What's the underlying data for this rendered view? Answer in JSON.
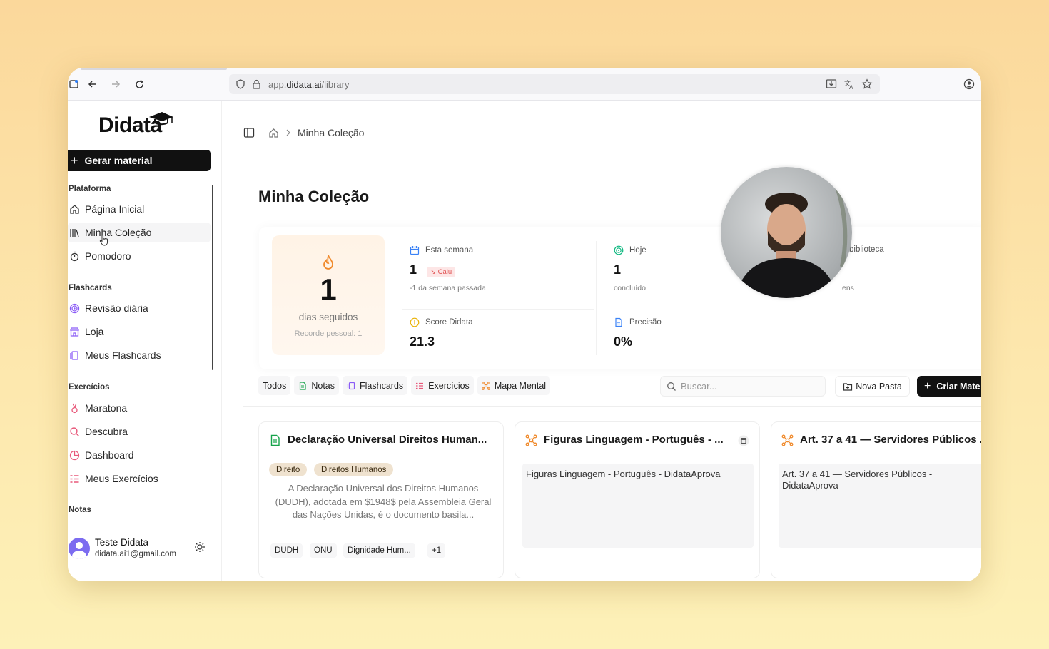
{
  "browser": {
    "url_prefix": "app.",
    "url_domain": "didata.ai",
    "url_path": "/library"
  },
  "sidebar": {
    "logo": "Didata",
    "generate_label": "Gerar material",
    "sections": {
      "plataforma": "Plataforma",
      "flashcards": "Flashcards",
      "exercicios": "Exercícios",
      "notas": "Notas"
    },
    "items": {
      "inicio": "Página Inicial",
      "colecao": "Minha Coleção",
      "pomodoro": "Pomodoro",
      "revisao": "Revisão diária",
      "loja": "Loja",
      "meus_flashcards": "Meus Flashcards",
      "maratona": "Maratona",
      "descubra": "Descubra",
      "dashboard": "Dashboard",
      "meus_exercicios": "Meus Exercícios"
    },
    "user": {
      "name": "Teste Didata",
      "email": "didata.ai1@gmail.com"
    }
  },
  "breadcrumb": {
    "current": "Minha Coleção"
  },
  "page_title": "Minha Coleção",
  "stats": {
    "streak": {
      "value": "1",
      "label": "dias seguidos",
      "record": "Recorde pessoal: 1"
    },
    "semana": {
      "label": "Esta semana",
      "value": "1",
      "badge": "Caiu",
      "sub": "-1 da semana passada"
    },
    "hoje": {
      "label": "Hoje",
      "value": "1",
      "sub": "concluído"
    },
    "score": {
      "label": "Score Didata",
      "value": "21.3"
    },
    "precisao": {
      "label": "Precisão",
      "value": "0%"
    },
    "biblioteca_partial": "biblioteca",
    "biblioteca_sub_partial": "ens"
  },
  "filters": [
    "Todos",
    "Notas",
    "Flashcards",
    "Exercícios",
    "Mapa Mental"
  ],
  "search": {
    "placeholder": "Buscar..."
  },
  "actions": {
    "nova_pasta": "Nova Pasta",
    "criar": "Criar Mate"
  },
  "cards": [
    {
      "title": "Declaração Universal Direitos Human...",
      "tags": [
        "Direito",
        "Direitos Humanos"
      ],
      "description": "A Declaração Universal dos Direitos Humanos (DUDH), adotada em $1948$ pela Assembleia Geral das Nações Unidas, é o documento basila...",
      "chips": [
        "DUDH",
        "ONU",
        "Dignidade Hum...",
        "+1"
      ]
    },
    {
      "title": "Figuras Linguagem - Português - ...",
      "preview": "Figuras Linguagem - Português - DidataAprova"
    },
    {
      "title": "Art. 37 a 41 — Servidores Públicos ...",
      "preview": "Art. 37 a 41  — Servidores Públicos - DidataAprova"
    }
  ],
  "colors": {
    "accent_dark": "#111111",
    "streak_orange": "#f08a2c",
    "tag_bg": "#efe2cf",
    "badge_red": "#e05151",
    "background_gradient": "#fbd89b"
  }
}
